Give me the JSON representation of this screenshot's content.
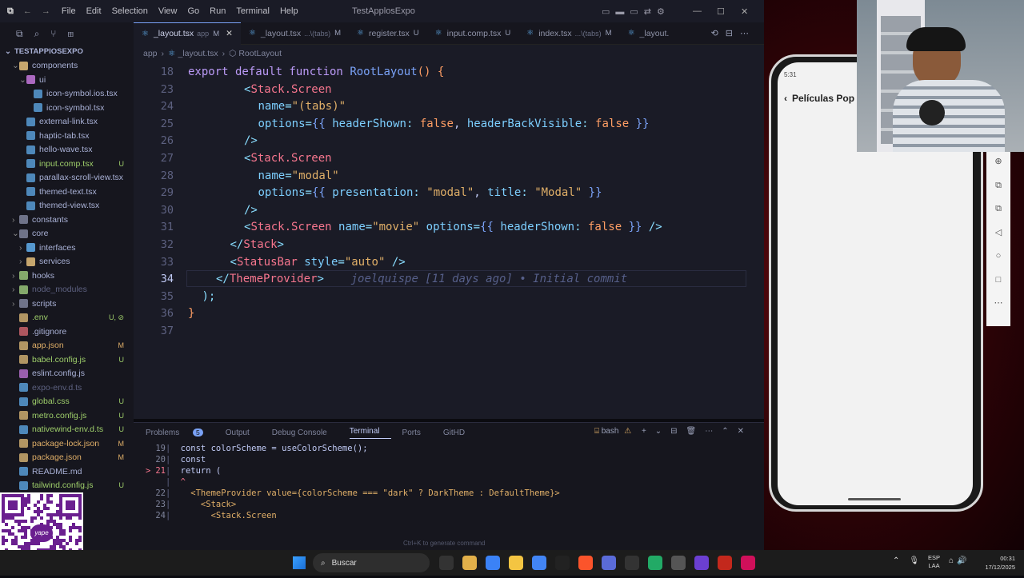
{
  "titlebar": {
    "menus": [
      "File",
      "Edit",
      "Selection",
      "View",
      "Go",
      "Run",
      "Terminal",
      "Help"
    ],
    "title": "TestApplosExpo"
  },
  "tabs": [
    {
      "label": "_layout.tsx",
      "sub": "app",
      "status": "M",
      "active": true
    },
    {
      "label": "_layout.tsx",
      "sub": "...\\(tabs)",
      "status": "M"
    },
    {
      "label": "register.tsx",
      "sub": "",
      "status": "U"
    },
    {
      "label": "input.comp.tsx",
      "sub": "",
      "status": "U"
    },
    {
      "label": "index.tsx",
      "sub": "...\\(tabs)",
      "status": "M"
    },
    {
      "label": "_layout.",
      "sub": "",
      "status": ""
    }
  ],
  "breadcrumb": {
    "a": "app",
    "b": "_layout.tsx",
    "c": "RootLayout"
  },
  "explorer": {
    "root": "TESTAPPIOSEXPO",
    "items": [
      {
        "label": "components",
        "indent": 1,
        "type": "folder",
        "open": true,
        "color": "#e5c07b"
      },
      {
        "label": "ui",
        "indent": 2,
        "type": "folder",
        "open": true,
        "color": "#c678dd"
      },
      {
        "label": "icon-symbol.ios.tsx",
        "indent": 3,
        "type": "file",
        "color": "#61afef"
      },
      {
        "label": "icon-symbol.tsx",
        "indent": 3,
        "type": "file",
        "color": "#61afef"
      },
      {
        "label": "external-link.tsx",
        "indent": 2,
        "type": "file",
        "color": "#61afef"
      },
      {
        "label": "haptic-tab.tsx",
        "indent": 2,
        "type": "file",
        "color": "#61afef"
      },
      {
        "label": "hello-wave.tsx",
        "indent": 2,
        "type": "file",
        "color": "#61afef"
      },
      {
        "label": "input.comp.tsx",
        "indent": 2,
        "type": "file",
        "color": "#61afef",
        "badge": "U",
        "green": true
      },
      {
        "label": "parallax-scroll-view.tsx",
        "indent": 2,
        "type": "file",
        "color": "#61afef"
      },
      {
        "label": "themed-text.tsx",
        "indent": 2,
        "type": "file",
        "color": "#61afef"
      },
      {
        "label": "themed-view.tsx",
        "indent": 2,
        "type": "file",
        "color": "#61afef"
      },
      {
        "label": "constants",
        "indent": 1,
        "type": "folder",
        "color": "#7f849c"
      },
      {
        "label": "core",
        "indent": 1,
        "type": "folder",
        "open": true,
        "color": "#7f849c"
      },
      {
        "label": "interfaces",
        "indent": 2,
        "type": "folder",
        "color": "#61afef"
      },
      {
        "label": "services",
        "indent": 2,
        "type": "folder",
        "color": "#e5c07b"
      },
      {
        "label": "hooks",
        "indent": 1,
        "type": "folder",
        "color": "#98c379"
      },
      {
        "label": "node_modules",
        "indent": 1,
        "type": "folder",
        "color": "#98c379",
        "dim": true
      },
      {
        "label": "scripts",
        "indent": 1,
        "type": "folder",
        "color": "#7f849c"
      },
      {
        "label": ".env",
        "indent": 1,
        "type": "file",
        "color": "#e5c07b",
        "badge": "U, ⊘",
        "green": true
      },
      {
        "label": ".gitignore",
        "indent": 1,
        "type": "file",
        "color": "#e06c75"
      },
      {
        "label": "app.json",
        "indent": 1,
        "type": "file",
        "color": "#e5c07b",
        "badge": "M"
      },
      {
        "label": "babel.config.js",
        "indent": 1,
        "type": "file",
        "color": "#e5c07b",
        "badge": "U",
        "green": true
      },
      {
        "label": "eslint.config.js",
        "indent": 1,
        "type": "file",
        "color": "#c678dd"
      },
      {
        "label": "expo-env.d.ts",
        "indent": 1,
        "type": "file",
        "color": "#61afef",
        "dim": true
      },
      {
        "label": "global.css",
        "indent": 1,
        "type": "file",
        "color": "#61afef",
        "badge": "U",
        "green": true
      },
      {
        "label": "metro.config.js",
        "indent": 1,
        "type": "file",
        "color": "#e5c07b",
        "badge": "U",
        "green": true
      },
      {
        "label": "nativewind-env.d.ts",
        "indent": 1,
        "type": "file",
        "color": "#61afef",
        "badge": "U",
        "green": true
      },
      {
        "label": "package-lock.json",
        "indent": 1,
        "type": "file",
        "color": "#e5c07b",
        "badge": "M"
      },
      {
        "label": "package.json",
        "indent": 1,
        "type": "file",
        "color": "#e5c07b",
        "badge": "M"
      },
      {
        "label": "README.md",
        "indent": 1,
        "type": "file",
        "color": "#61afef"
      },
      {
        "label": "tailwind.config.js",
        "indent": 1,
        "type": "file",
        "color": "#61afef",
        "badge": "U",
        "green": true
      }
    ],
    "extra_badge": "M"
  },
  "editor": {
    "lines": [
      {
        "n": "18",
        "html": "<span class='kw'>export default function</span> <span class='fn'>RootLayout</span><span class='bl'>()</span> <span class='bl'>{</span>",
        "indent": 0
      },
      {
        "n": "23",
        "html": "<span class='pu'>&lt;</span><span class='tg'>Stack.Screen</span>",
        "indent": 4
      },
      {
        "n": "24",
        "html": "<span class='at'>name</span><span class='pu'>=</span><span class='str'>\"(tabs)\"</span>",
        "indent": 5
      },
      {
        "n": "25",
        "html": "<span class='at'>options</span><span class='pu'>=</span><span class='fn'>{{</span> <span class='at'>headerShown</span><span class='pu'>:</span> <span class='bl'>false</span>, <span class='at'>headerBackVisible</span><span class='pu'>:</span> <span class='bl'>false</span> <span class='fn'>}}</span>",
        "indent": 5
      },
      {
        "n": "26",
        "html": "<span class='pu'>/&gt;</span>",
        "indent": 4
      },
      {
        "n": "27",
        "html": "<span class='pu'>&lt;</span><span class='tg'>Stack.Screen</span>",
        "indent": 4
      },
      {
        "n": "28",
        "html": "<span class='at'>name</span><span class='pu'>=</span><span class='str'>\"modal\"</span>",
        "indent": 5
      },
      {
        "n": "29",
        "html": "<span class='at'>options</span><span class='pu'>=</span><span class='fn'>{{</span> <span class='at'>presentation</span><span class='pu'>:</span> <span class='str'>\"modal\"</span>, <span class='at'>title</span><span class='pu'>:</span> <span class='str'>\"Modal\"</span> <span class='fn'>}}</span>",
        "indent": 5
      },
      {
        "n": "30",
        "html": "<span class='pu'>/&gt;</span>",
        "indent": 4
      },
      {
        "n": "31",
        "html": "<span class='pu'>&lt;</span><span class='tg'>Stack.Screen</span> <span class='at'>name</span><span class='pu'>=</span><span class='str'>\"movie\"</span> <span class='at'>options</span><span class='pu'>=</span><span class='fn'>{{</span> <span class='at'>headerShown</span><span class='pu'>:</span> <span class='bl'>false</span> <span class='fn'>}}</span> <span class='pu'>/&gt;</span>",
        "indent": 4
      },
      {
        "n": "32",
        "html": "<span class='pu'>&lt;/</span><span class='tg'>Stack</span><span class='pu'>&gt;</span>",
        "indent": 3
      },
      {
        "n": "33",
        "html": "<span class='pu'>&lt;</span><span class='tg'>StatusBar</span> <span class='at'>style</span><span class='pu'>=</span><span class='str'>\"auto\"</span> <span class='pu'>/&gt;</span>",
        "indent": 3
      },
      {
        "n": "34",
        "html": "<span class='pu'>&lt;/</span><span class='tg'>ThemeProvider</span><span class='pu'>&gt;</span>    <span style='color:#565f89;font-style:italic'>joelquispe [11 days ago] • Initial commit</span>",
        "indent": 2
      },
      {
        "n": "35",
        "html": "<span class='pu'>);</span>",
        "indent": 1
      },
      {
        "n": "36",
        "html": "<span class='bl'>}</span>",
        "indent": 0
      },
      {
        "n": "37",
        "html": "",
        "indent": 0
      }
    ]
  },
  "panel": {
    "tabs": [
      "Problems",
      "Output",
      "Debug Console",
      "Terminal",
      "Ports",
      "GitHD"
    ],
    "problems_count": "5",
    "shell": "bash",
    "terminal": [
      {
        "n": "19",
        "text": "  const colorScheme = useColorScheme();"
      },
      {
        "n": "20",
        "text": "  const"
      },
      {
        "n": "21",
        "text": "  return (",
        "err": true
      },
      {
        "n": "",
        "text": "  ^"
      },
      {
        "n": "22",
        "text": "    <ThemeProvider value={colorScheme === \"dark\" ? DarkTheme : DefaultTheme}>"
      },
      {
        "n": "23",
        "text": "      <Stack>"
      },
      {
        "n": "24",
        "text": "        <Stack.Screen"
      }
    ],
    "hint": "Ctrl+K to generate command"
  },
  "phone": {
    "time": "5:31",
    "header": "Películas Pop"
  },
  "taskbar": {
    "search": "Buscar",
    "lang": "ESP",
    "lang2": "LAA",
    "time": "00:31",
    "date": "17/12/2025"
  },
  "qr": {
    "label": "yape"
  }
}
